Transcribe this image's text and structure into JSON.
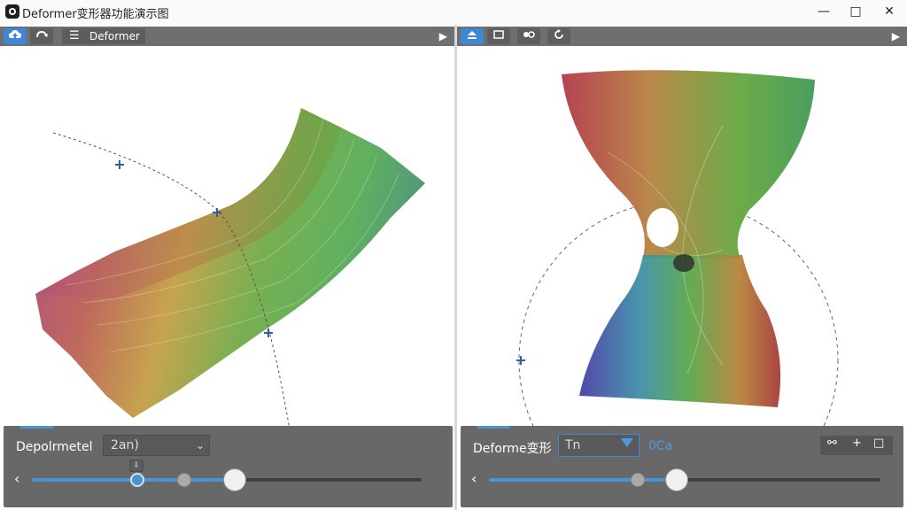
{
  "window": {
    "title": "Deformer变形器功能演示图",
    "buttons": [
      "—",
      "□",
      "✕"
    ]
  },
  "left_panel": {
    "toolbar": {
      "menu_label": "Deformer",
      "left_tools": [
        "cloud-up-icon",
        "rotate-icon"
      ],
      "arrow": "▶"
    },
    "bottom": {
      "param_label": "Depolrmetel",
      "field_value": "2an)",
      "field_chevron": "⌄",
      "marker_glyph": "⇓",
      "slider": {
        "fill_fraction": 0.52,
        "small_knob_fraction": 0.27,
        "mid_knob_fraction": 0.39,
        "big_knob_fraction": 0.52
      },
      "left_arrow": "‹"
    }
  },
  "right_panel": {
    "toolbar": {
      "tools": [
        "eject-icon",
        "frame-icon",
        "mirror-icon",
        "refresh-icon"
      ],
      "arrow": "▶"
    },
    "bottom": {
      "param_label": "Deforme变形",
      "dropdown_value": "Tn",
      "secondary_value": "0Ca",
      "slider": {
        "fill_fraction": 0.48,
        "mid_knob_fraction": 0.38,
        "big_knob_fraction": 0.48
      },
      "icon_buttons": [
        "link-icon",
        "plus-icon",
        "square-icon"
      ],
      "icon_labels": [
        "⚯",
        "+",
        "□"
      ],
      "left_arrow": "‹"
    }
  }
}
